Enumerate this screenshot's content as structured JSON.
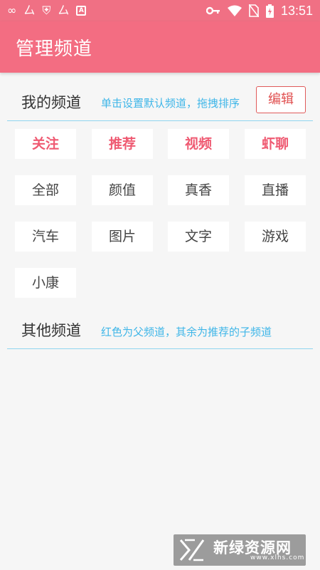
{
  "status_bar": {
    "left_icons": [
      "infinity-icon",
      "app-icon",
      "shield-icon",
      "app-icon",
      "a-icon"
    ],
    "right_icons": [
      "key-icon",
      "wifi-icon",
      "no-sim-icon",
      "battery-charging-icon"
    ],
    "time": "13:51"
  },
  "app_bar": {
    "title": "管理频道"
  },
  "my_channels": {
    "title": "我的频道",
    "hint": "单击设置默认频道，拖拽排序",
    "edit_label": "编辑",
    "items": [
      {
        "label": "关注",
        "parent": true
      },
      {
        "label": "推荐",
        "parent": true
      },
      {
        "label": "视频",
        "parent": true
      },
      {
        "label": "虾聊",
        "parent": true
      },
      {
        "label": "全部",
        "parent": false
      },
      {
        "label": "颜值",
        "parent": false
      },
      {
        "label": "真香",
        "parent": false
      },
      {
        "label": "直播",
        "parent": false
      },
      {
        "label": "汽车",
        "parent": false
      },
      {
        "label": "图片",
        "parent": false
      },
      {
        "label": "文字",
        "parent": false
      },
      {
        "label": "游戏",
        "parent": false
      },
      {
        "label": "小康",
        "parent": false
      }
    ]
  },
  "other_channels": {
    "title": "其他频道",
    "hint": "红色为父频道，其余为推荐的子频道"
  },
  "watermark": {
    "name": "新绿资源网",
    "url": "www.xlhs.com"
  },
  "colors": {
    "status_bar": "#f07084",
    "app_bar": "#f36d82",
    "accent_parent": "#ef5a72",
    "hint": "#3fb6e8",
    "divider": "#8fd5ef"
  }
}
